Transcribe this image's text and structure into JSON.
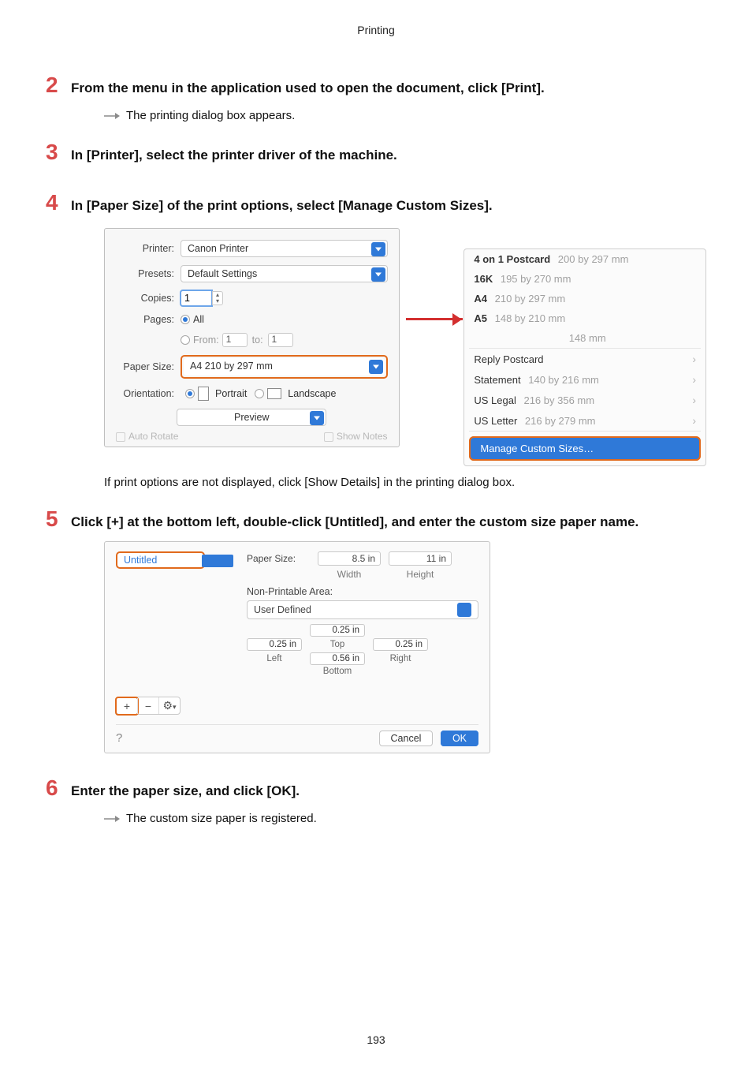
{
  "header": "Printing",
  "page_number": "193",
  "steps": {
    "s2": {
      "num": "2",
      "title": "From the menu in the application used to open the document, click [Print].",
      "note": "The printing dialog box appears."
    },
    "s3": {
      "num": "3",
      "title": "In [Printer], select the printer driver of the machine."
    },
    "s4": {
      "num": "4",
      "title": "In [Paper Size] of the print options, select [Manage Custom Sizes].",
      "caption": "If print options are not displayed, click [Show Details] in the printing dialog box."
    },
    "s5": {
      "num": "5",
      "title": "Click [+] at the bottom left, double-click [Untitled], and enter the custom size paper name."
    },
    "s6": {
      "num": "6",
      "title": "Enter the paper size, and click [OK].",
      "note": "The custom size paper is registered."
    }
  },
  "fig1": {
    "labels": {
      "printer": "Printer:",
      "presets": "Presets:",
      "copies": "Copies:",
      "pages": "Pages:",
      "paper_size": "Paper Size:",
      "orientation": "Orientation:"
    },
    "values": {
      "printer": "Canon Printer",
      "presets": "Default Settings",
      "copies": "1",
      "pages_all": "All",
      "from_label": "From:",
      "from": "1",
      "to_label": "to:",
      "to": "1",
      "paper_size": "A4 210 by 297 mm",
      "portrait": "Portrait",
      "landscape": "Landscape",
      "preview": "Preview",
      "auto_rotate": "Auto Rotate",
      "show_notes": "Show Notes"
    },
    "menu": [
      {
        "name": "4 on 1 Postcard",
        "dim": "200 by 297 mm",
        "bold": true,
        "chev": false
      },
      {
        "name": "16K",
        "dim": "195 by 270 mm",
        "bold": true,
        "chev": false
      },
      {
        "name": "A4",
        "dim": "210 by 297 mm",
        "bold": true,
        "chev": false
      },
      {
        "name": "A5",
        "dim": "148 by 210 mm",
        "bold": true,
        "chev": false
      },
      {
        "name": "",
        "dim": "148 mm",
        "bold": false,
        "chev": false
      },
      {
        "name": "Reply Postcard",
        "dim": "",
        "bold": false,
        "chev": true
      },
      {
        "name": "Statement",
        "dim": "140 by 216 mm",
        "bold": false,
        "chev": true
      },
      {
        "name": "US Legal",
        "dim": "216 by 356 mm",
        "bold": false,
        "chev": true
      },
      {
        "name": "US Letter",
        "dim": "216 by 279 mm",
        "bold": false,
        "chev": true
      }
    ],
    "manage": "Manage Custom Sizes…"
  },
  "fig2": {
    "untitled": "Untitled",
    "paper_size_label": "Paper Size:",
    "width_val": "8.5 in",
    "height_val": "11 in",
    "width_label": "Width",
    "height_label": "Height",
    "nonprint_label": "Non-Printable Area:",
    "user_defined": "User Defined",
    "top_val": "0.25 in",
    "top_label": "Top",
    "left_val": "0.25 in",
    "left_label": "Left",
    "right_val": "0.25 in",
    "right_label": "Right",
    "bottom_val": "0.56 in",
    "bottom_label": "Bottom",
    "plus": "+",
    "minus": "−",
    "gear": "⚙︎",
    "help": "?",
    "cancel": "Cancel",
    "ok": "OK"
  }
}
